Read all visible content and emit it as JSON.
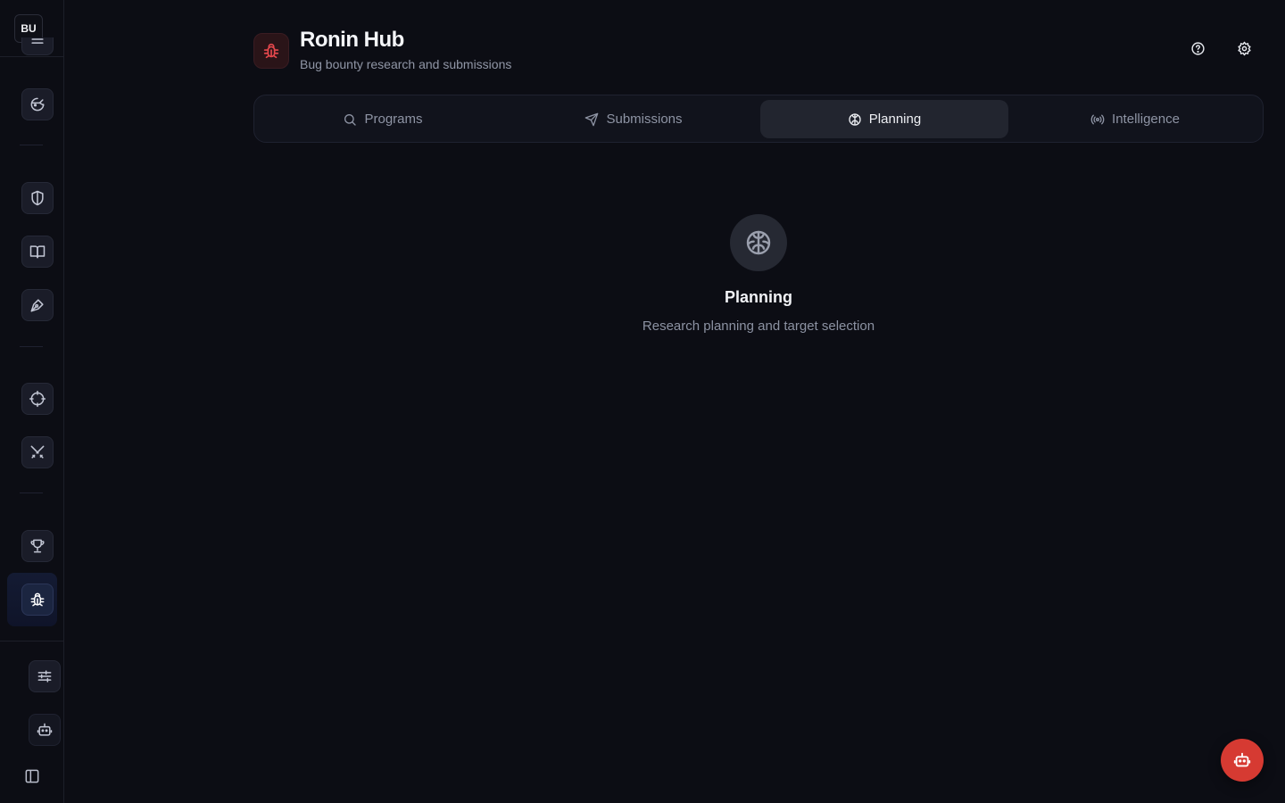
{
  "workspace": {
    "badge": "BU"
  },
  "sidebar": {
    "items": [
      {
        "name": "nav-item-ninja",
        "icon": "ninja-icon"
      },
      {
        "name": "nav-item-security",
        "icon": "shield-icon"
      },
      {
        "name": "nav-item-docs",
        "icon": "book-icon"
      },
      {
        "name": "nav-item-pentest",
        "icon": "pen-tool-icon"
      },
      {
        "name": "nav-item-recon",
        "icon": "crosshair-icon"
      },
      {
        "name": "nav-item-attack",
        "icon": "swords-icon"
      },
      {
        "name": "nav-item-achievements",
        "icon": "trophy-icon"
      },
      {
        "name": "nav-item-bug-bounty",
        "icon": "bug-icon",
        "active": true
      }
    ],
    "bottom": [
      "settings-sliders-icon",
      "bot-icon",
      "panel-left-icon"
    ]
  },
  "header": {
    "title": "Ronin Hub",
    "subtitle": "Bug bounty research and submissions",
    "logo_icon": "bug-icon",
    "accent": "#e5484d"
  },
  "tabs": [
    {
      "label": "Programs",
      "icon": "search-icon",
      "active": false
    },
    {
      "label": "Submissions",
      "icon": "send-icon",
      "active": false
    },
    {
      "label": "Planning",
      "icon": "brain-icon",
      "active": true
    },
    {
      "label": "Intelligence",
      "icon": "radio-icon",
      "active": false
    }
  ],
  "empty_state": {
    "icon": "brain-icon",
    "title": "Planning",
    "description": "Research planning and target selection"
  },
  "fab": {
    "icon": "bot-icon",
    "color": "#d63a32"
  }
}
